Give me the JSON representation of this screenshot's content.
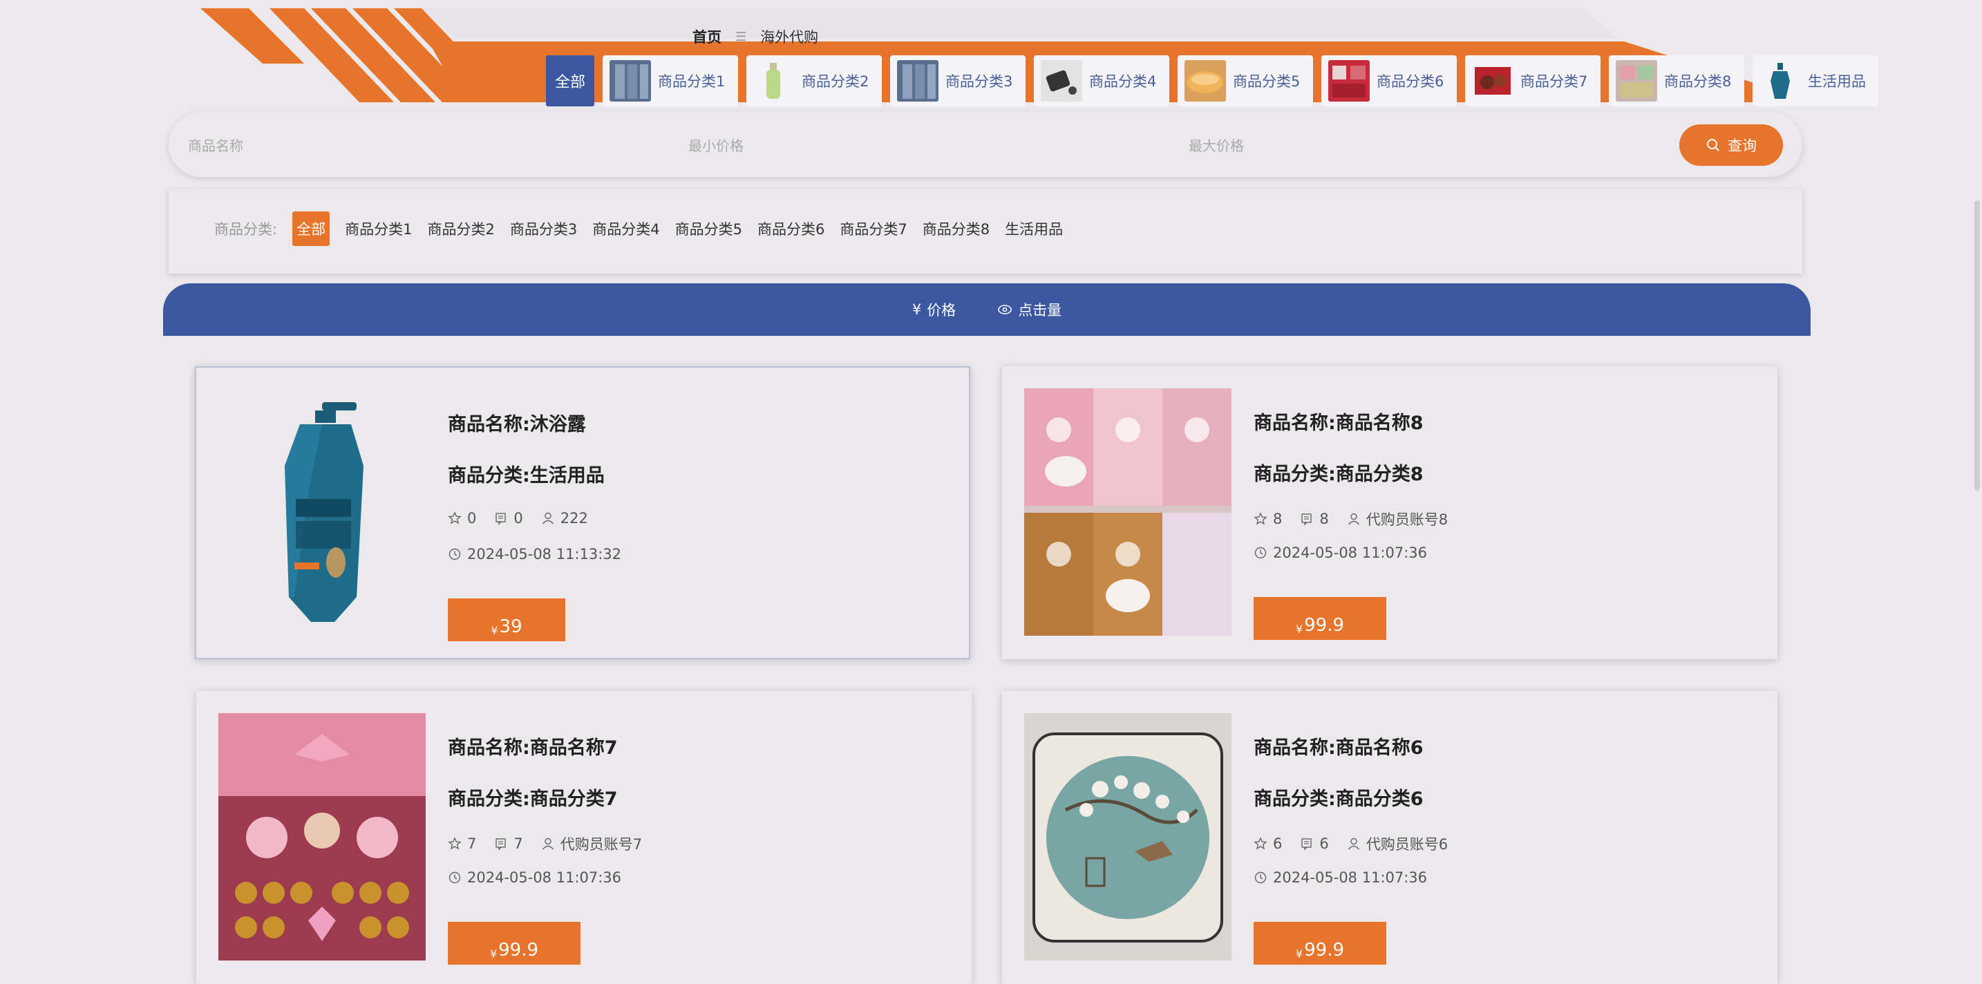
{
  "breadcrumb": {
    "home": "首页",
    "separator": "☰",
    "current": "海外代购"
  },
  "category_tabs": {
    "all_label": "全部",
    "items": [
      {
        "label": "商品分类1"
      },
      {
        "label": "商品分类2"
      },
      {
        "label": "商品分类3"
      },
      {
        "label": "商品分类4"
      },
      {
        "label": "商品分类5"
      },
      {
        "label": "商品分类6"
      },
      {
        "label": "商品分类7"
      },
      {
        "label": "商品分类8"
      },
      {
        "label": "生活用品"
      }
    ]
  },
  "search": {
    "name_placeholder": "商品名称",
    "min_price_placeholder": "最小价格",
    "max_price_placeholder": "最大价格",
    "button_label": "查询"
  },
  "filter": {
    "label": "商品分类:",
    "items": [
      "全部",
      "商品分类1",
      "商品分类2",
      "商品分类3",
      "商品分类4",
      "商品分类5",
      "商品分类6",
      "商品分类7",
      "商品分类8",
      "生活用品"
    ],
    "active": "全部"
  },
  "sort": {
    "price_label": "价格",
    "clicks_label": "点击量",
    "price_icon": "¥"
  },
  "products": [
    {
      "name": "商品名称:沐浴露",
      "category": "商品分类:生活用品",
      "likes": "0",
      "comments": "0",
      "user": "222",
      "time": "2024-05-08 11:13:32",
      "currency": "¥",
      "price": "39"
    },
    {
      "name": "商品名称:商品名称8",
      "category": "商品分类:商品分类8",
      "likes": "8",
      "comments": "8",
      "user": "代购员账号8",
      "time": "2024-05-08 11:07:36",
      "currency": "¥",
      "price": "99.9"
    },
    {
      "name": "商品名称:商品名称7",
      "category": "商品分类:商品分类7",
      "likes": "7",
      "comments": "7",
      "user": "代购员账号7",
      "time": "2024-05-08 11:07:36",
      "currency": "¥",
      "price": "99.9"
    },
    {
      "name": "商品名称:商品名称6",
      "category": "商品分类:商品分类6",
      "likes": "6",
      "comments": "6",
      "user": "代购员账号6",
      "time": "2024-05-08 11:07:36",
      "currency": "¥",
      "price": "99.9"
    }
  ],
  "colors": {
    "accent": "#e8732a",
    "brand_blue": "#3b57a0",
    "background": "#ebe9ec"
  }
}
